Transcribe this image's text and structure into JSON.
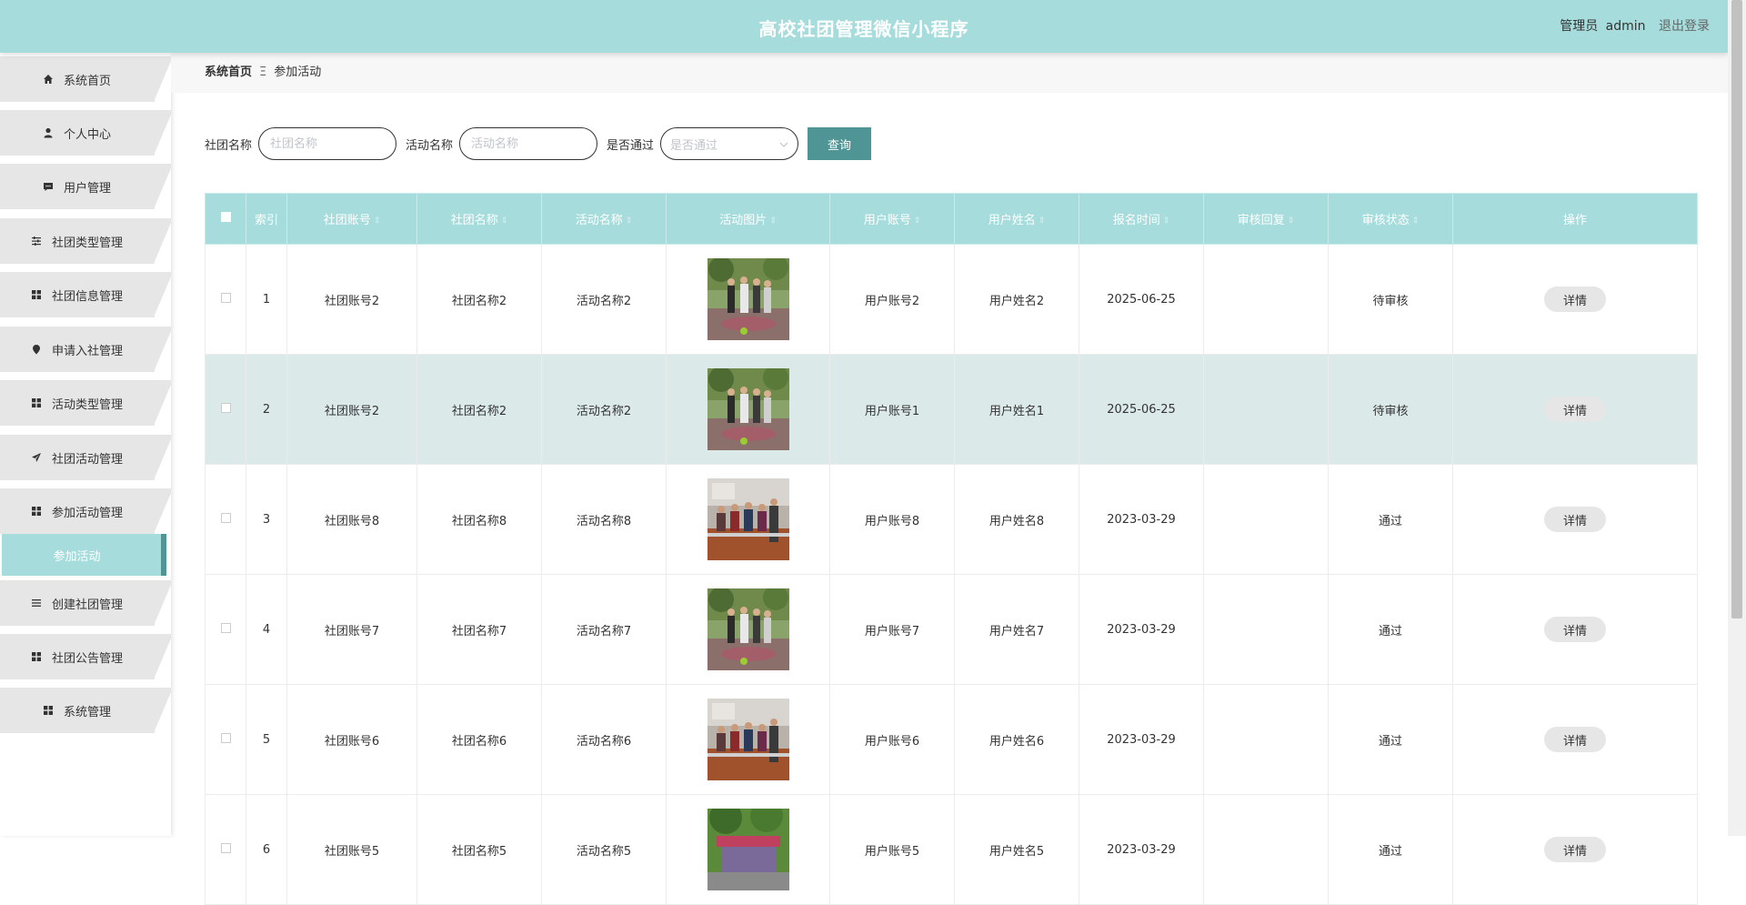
{
  "header": {
    "title": "高校社团管理微信小程序",
    "role": "管理员",
    "username": "admin",
    "logout": "退出登录",
    "background": "#a6dcdc"
  },
  "sidebar": {
    "items": [
      {
        "label": "系统首页",
        "icon": "home-icon"
      },
      {
        "label": "个人中心",
        "icon": "user-icon"
      },
      {
        "label": "用户管理",
        "icon": "chat-icon"
      },
      {
        "label": "社团类型管理",
        "icon": "sliders-icon"
      },
      {
        "label": "社团信息管理",
        "icon": "grid-icon"
      },
      {
        "label": "申请入社管理",
        "icon": "pin-icon"
      },
      {
        "label": "活动类型管理",
        "icon": "grid-icon"
      },
      {
        "label": "社团活动管理",
        "icon": "send-icon"
      },
      {
        "label": "参加活动管理",
        "icon": "grid-icon"
      },
      {
        "label": "创建社团管理",
        "icon": "list-icon"
      },
      {
        "label": "社团公告管理",
        "icon": "grid-icon"
      },
      {
        "label": "系统管理",
        "icon": "grid-icon"
      }
    ],
    "active_sub": "参加活动"
  },
  "breadcrumb": {
    "home": "系统首页",
    "separator": "Ξ",
    "current": "参加活动"
  },
  "search": {
    "club_label": "社团名称",
    "club_placeholder": "社团名称",
    "activity_label": "活动名称",
    "activity_placeholder": "活动名称",
    "passed_label": "是否通过",
    "passed_placeholder": "是否通过",
    "query_button": "查询"
  },
  "table": {
    "columns": [
      "索引",
      "社团账号",
      "社团名称",
      "活动名称",
      "活动图片",
      "用户账号",
      "用户姓名",
      "报名时间",
      "审核回复",
      "审核状态",
      "操作"
    ],
    "rows": [
      {
        "index": "1",
        "club_account": "社团账号2",
        "club_name": "社团名称2",
        "activity_name": "活动名称2",
        "image": "soccer-photo",
        "user_account": "用户账号2",
        "user_name": "用户姓名2",
        "signup_time": "2025-06-25",
        "reply": "",
        "status": "待审核",
        "action": "详情"
      },
      {
        "index": "2",
        "club_account": "社团账号2",
        "club_name": "社团名称2",
        "activity_name": "活动名称2",
        "image": "soccer-photo",
        "user_account": "用户账号1",
        "user_name": "用户姓名1",
        "signup_time": "2025-06-25",
        "reply": "",
        "status": "待审核",
        "action": "详情"
      },
      {
        "index": "3",
        "club_account": "社团账号8",
        "club_name": "社团名称8",
        "activity_name": "活动名称8",
        "image": "meeting-photo",
        "user_account": "用户账号8",
        "user_name": "用户姓名8",
        "signup_time": "2023-03-29",
        "reply": "",
        "status": "通过",
        "action": "详情"
      },
      {
        "index": "4",
        "club_account": "社团账号7",
        "club_name": "社团名称7",
        "activity_name": "活动名称7",
        "image": "soccer-photo",
        "user_account": "用户账号7",
        "user_name": "用户姓名7",
        "signup_time": "2023-03-29",
        "reply": "",
        "status": "通过",
        "action": "详情"
      },
      {
        "index": "5",
        "club_account": "社团账号6",
        "club_name": "社团名称6",
        "activity_name": "活动名称6",
        "image": "meeting-photo",
        "user_account": "用户账号6",
        "user_name": "用户姓名6",
        "signup_time": "2023-03-29",
        "reply": "",
        "status": "通过",
        "action": "详情"
      },
      {
        "index": "6",
        "club_account": "社团账号5",
        "club_name": "社团名称5",
        "activity_name": "活动名称5",
        "image": "outdoor-photo",
        "user_account": "用户账号5",
        "user_name": "用户姓名5",
        "signup_time": "2023-03-29",
        "reply": "",
        "status": "通过",
        "action": "详情"
      }
    ]
  },
  "colors": {
    "accent": "#a6dcdc",
    "button": "#4f9595",
    "row_highlight": "#dce9e9"
  }
}
